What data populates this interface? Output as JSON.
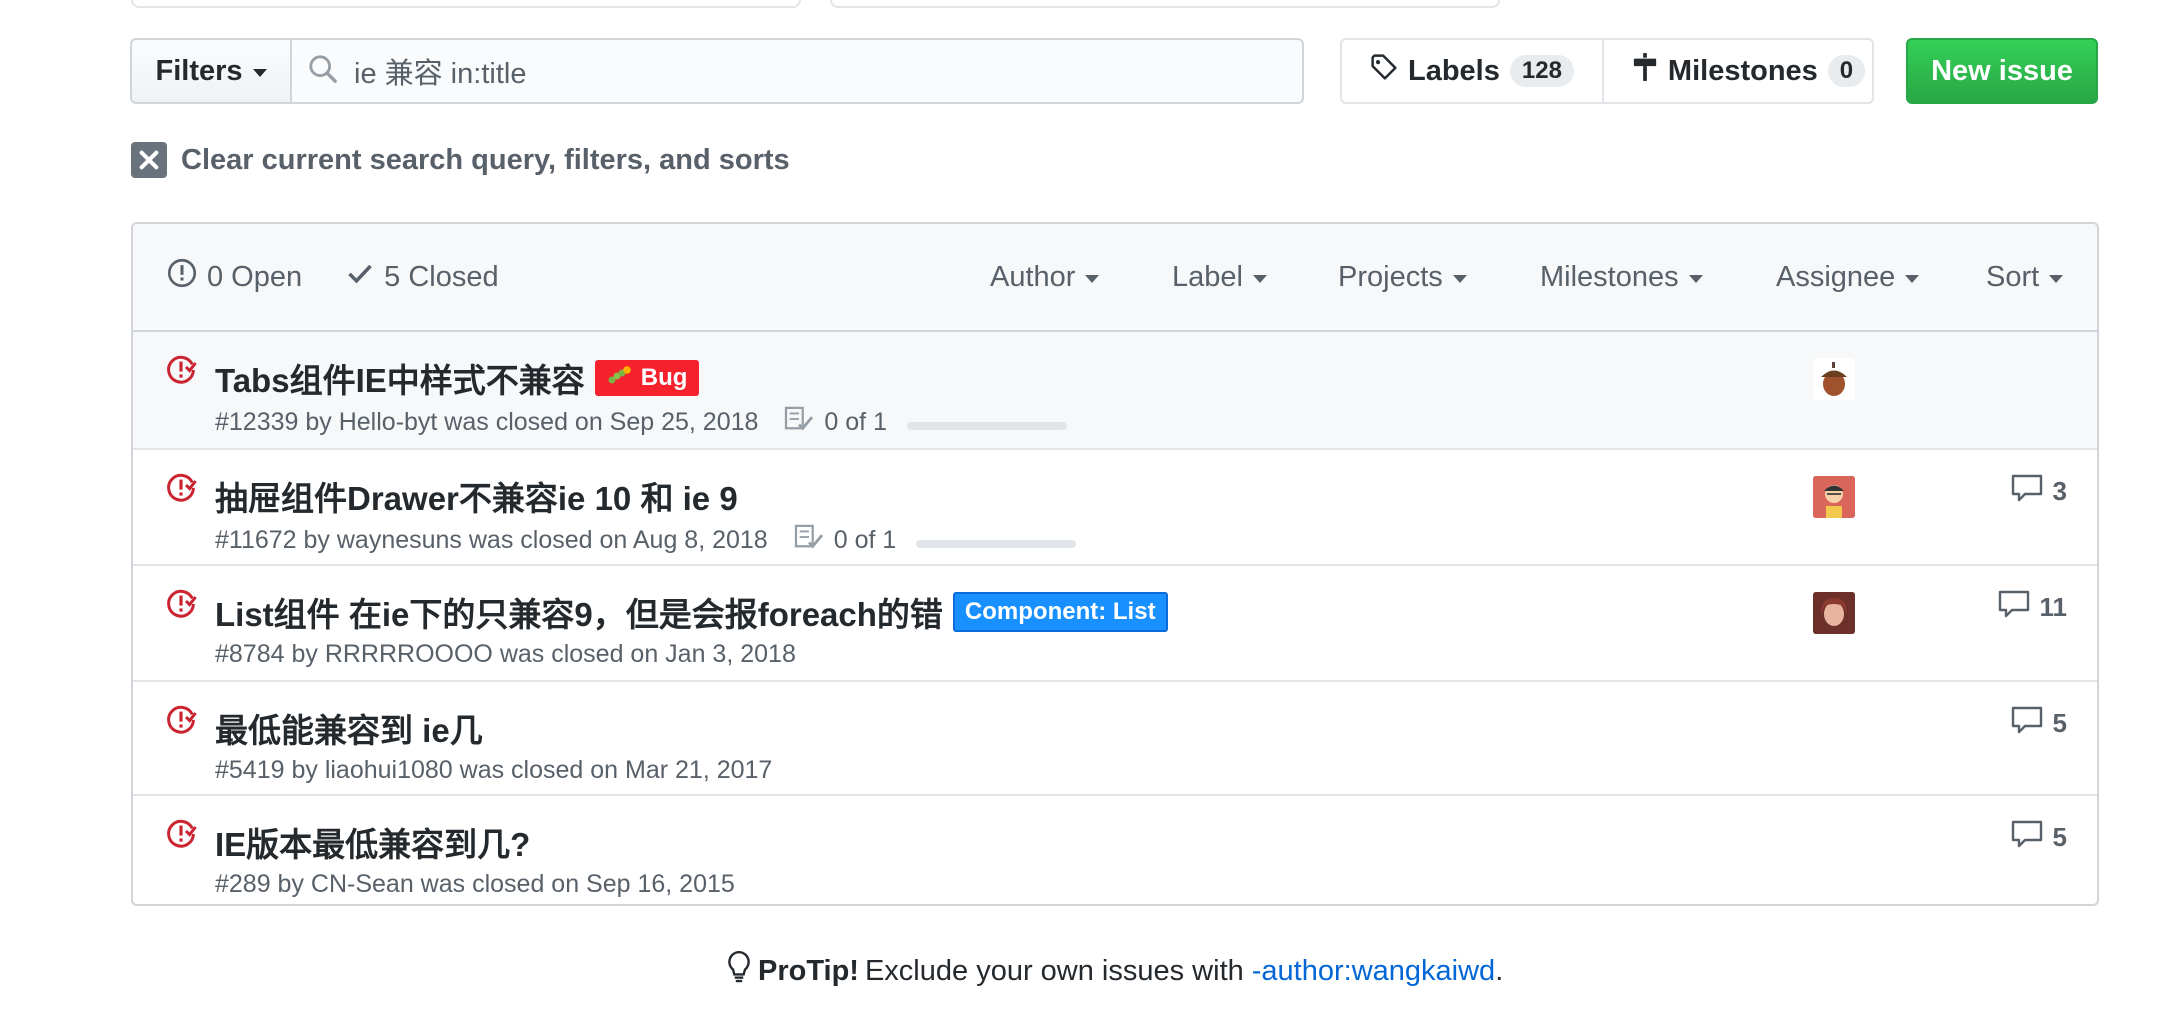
{
  "toolbar": {
    "filters_label": "Filters",
    "search_value": "ie 兼容 in:title",
    "labels_label": "Labels",
    "labels_count": "128",
    "milestones_label": "Milestones",
    "milestones_count": "0",
    "new_issue_label": "New issue",
    "clear_label": "Clear current search query, filters, and sorts"
  },
  "header": {
    "open_label": "0 Open",
    "closed_label": "5 Closed",
    "filters": [
      "Author",
      "Label",
      "Projects",
      "Milestones",
      "Assignee",
      "Sort"
    ]
  },
  "issues": [
    {
      "title": "Tabs组件IE中样式不兼容",
      "meta": "#12339 by Hello-byt was closed on Sep 25, 2018",
      "label": "Bug",
      "tasks": "0 of 1",
      "comments": ""
    },
    {
      "title": " 抽屉组件Drawer不兼容ie 10 和 ie 9",
      "meta": "#11672 by waynesuns was closed on Aug 8, 2018",
      "tasks": "0 of 1",
      "comments": "3"
    },
    {
      "title": "List组件 在ie下的只兼容9，但是会报foreach的错",
      "meta": "#8784 by RRRRROOOO was closed on Jan 3, 2018",
      "label": "Component: List",
      "comments": "11"
    },
    {
      "title": "最低能兼容到 ie几",
      "meta": "#5419 by liaohui1080 was closed on Mar 21, 2017",
      "comments": "5"
    },
    {
      "title": "IE版本最低兼容到几?",
      "meta": "#289 by CN-Sean was closed on Sep 16, 2015",
      "comments": "5"
    }
  ],
  "protip": {
    "bold": "ProTip!",
    "text": "Exclude your own issues with",
    "link": "-author:wangkaiwd",
    "end": "."
  },
  "colors": {
    "closed_icon": "#cb2431",
    "new_issue_bg": "#28a745",
    "bug_label": "#f5222d",
    "component_label": "#1890ff",
    "link": "#0366d6"
  },
  "icons": [
    "search-icon",
    "tag-icon",
    "milestone-icon",
    "close-icon",
    "issue-opened-icon",
    "check-icon",
    "issue-closed-icon",
    "tasklist-icon",
    "comment-icon",
    "light-bulb-icon"
  ]
}
